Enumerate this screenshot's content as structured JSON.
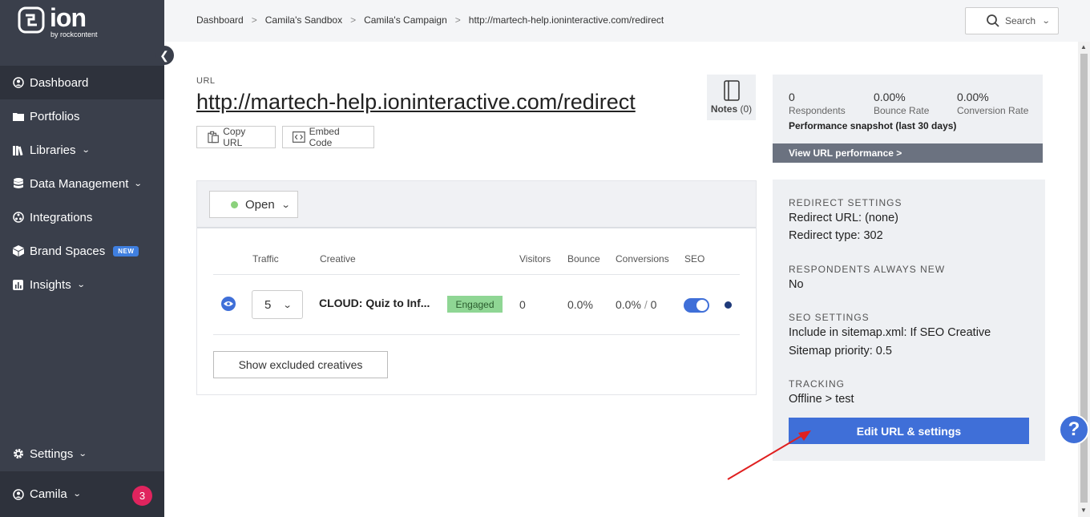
{
  "logo": {
    "name": "ion",
    "sub": "by rockcontent"
  },
  "sidebar": {
    "items": [
      {
        "label": "Dashboard",
        "icon": "dashboard-icon",
        "active": true
      },
      {
        "label": "Portfolios",
        "icon": "folder-icon"
      },
      {
        "label": "Libraries",
        "icon": "libraries-icon",
        "expandable": true
      },
      {
        "label": "Data Management",
        "icon": "database-icon",
        "expandable": true
      },
      {
        "label": "Integrations",
        "icon": "integrations-icon"
      },
      {
        "label": "Brand Spaces",
        "icon": "cube-icon",
        "badge": "NEW"
      },
      {
        "label": "Insights",
        "icon": "chart-icon",
        "expandable": true
      }
    ],
    "settings_label": "Settings",
    "user_label": "Camila",
    "notification_count": "3"
  },
  "breadcrumb": {
    "items": [
      "Dashboard",
      "Camila's Sandbox",
      "Camila's Campaign",
      "http://martech-help.ioninteractive.com/redirect"
    ],
    "separator": ">"
  },
  "search": {
    "label": "Search"
  },
  "url_section": {
    "label": "URL",
    "url": "http://martech-help.ioninteractive.com/redirect",
    "copy_label": "Copy URL",
    "embed_label": "Embed Code",
    "notes_label": "Notes",
    "notes_count": "(0)"
  },
  "creatives": {
    "status": "Open",
    "headers": {
      "traffic": "Traffic",
      "creative": "Creative",
      "visitors": "Visitors",
      "bounce": "Bounce",
      "conversions": "Conversions",
      "seo": "SEO"
    },
    "row": {
      "traffic": "5",
      "name": "CLOUD: Quiz to Inf...",
      "status": "Engaged",
      "visitors": "0",
      "bounce": "0.0%",
      "conversions_pct": "0.0%",
      "conversions_sep": "/",
      "conversions_count": "0",
      "seo_on": true
    },
    "show_excluded_label": "Show excluded creatives"
  },
  "performance": {
    "respondents_value": "0",
    "respondents_label": "Respondents",
    "bounce_value": "0.00%",
    "bounce_label": "Bounce Rate",
    "conversion_value": "0.00%",
    "conversion_label": "Conversion Rate",
    "snapshot_label": "Performance snapshot (last 30 days)",
    "link_label": "View URL performance >"
  },
  "settings_panel": {
    "redirect_heading": "REDIRECT SETTINGS",
    "redirect_url": "Redirect URL: (none)",
    "redirect_type": "Redirect type: 302",
    "respondents_heading": "RESPONDENTS ALWAYS NEW",
    "respondents_value": "No",
    "seo_heading": "SEO SETTINGS",
    "seo_sitemap": "Include in sitemap.xml: If SEO Creative",
    "seo_priority": "Sitemap priority: 0.5",
    "tracking_heading": "TRACKING",
    "tracking_value": "Offline > test",
    "edit_label": "Edit URL & settings"
  },
  "help": {
    "label": "?"
  },
  "colors": {
    "accent": "#3f6fd8",
    "sidebar": "#3a3f4b",
    "annotation": "#e02020"
  }
}
